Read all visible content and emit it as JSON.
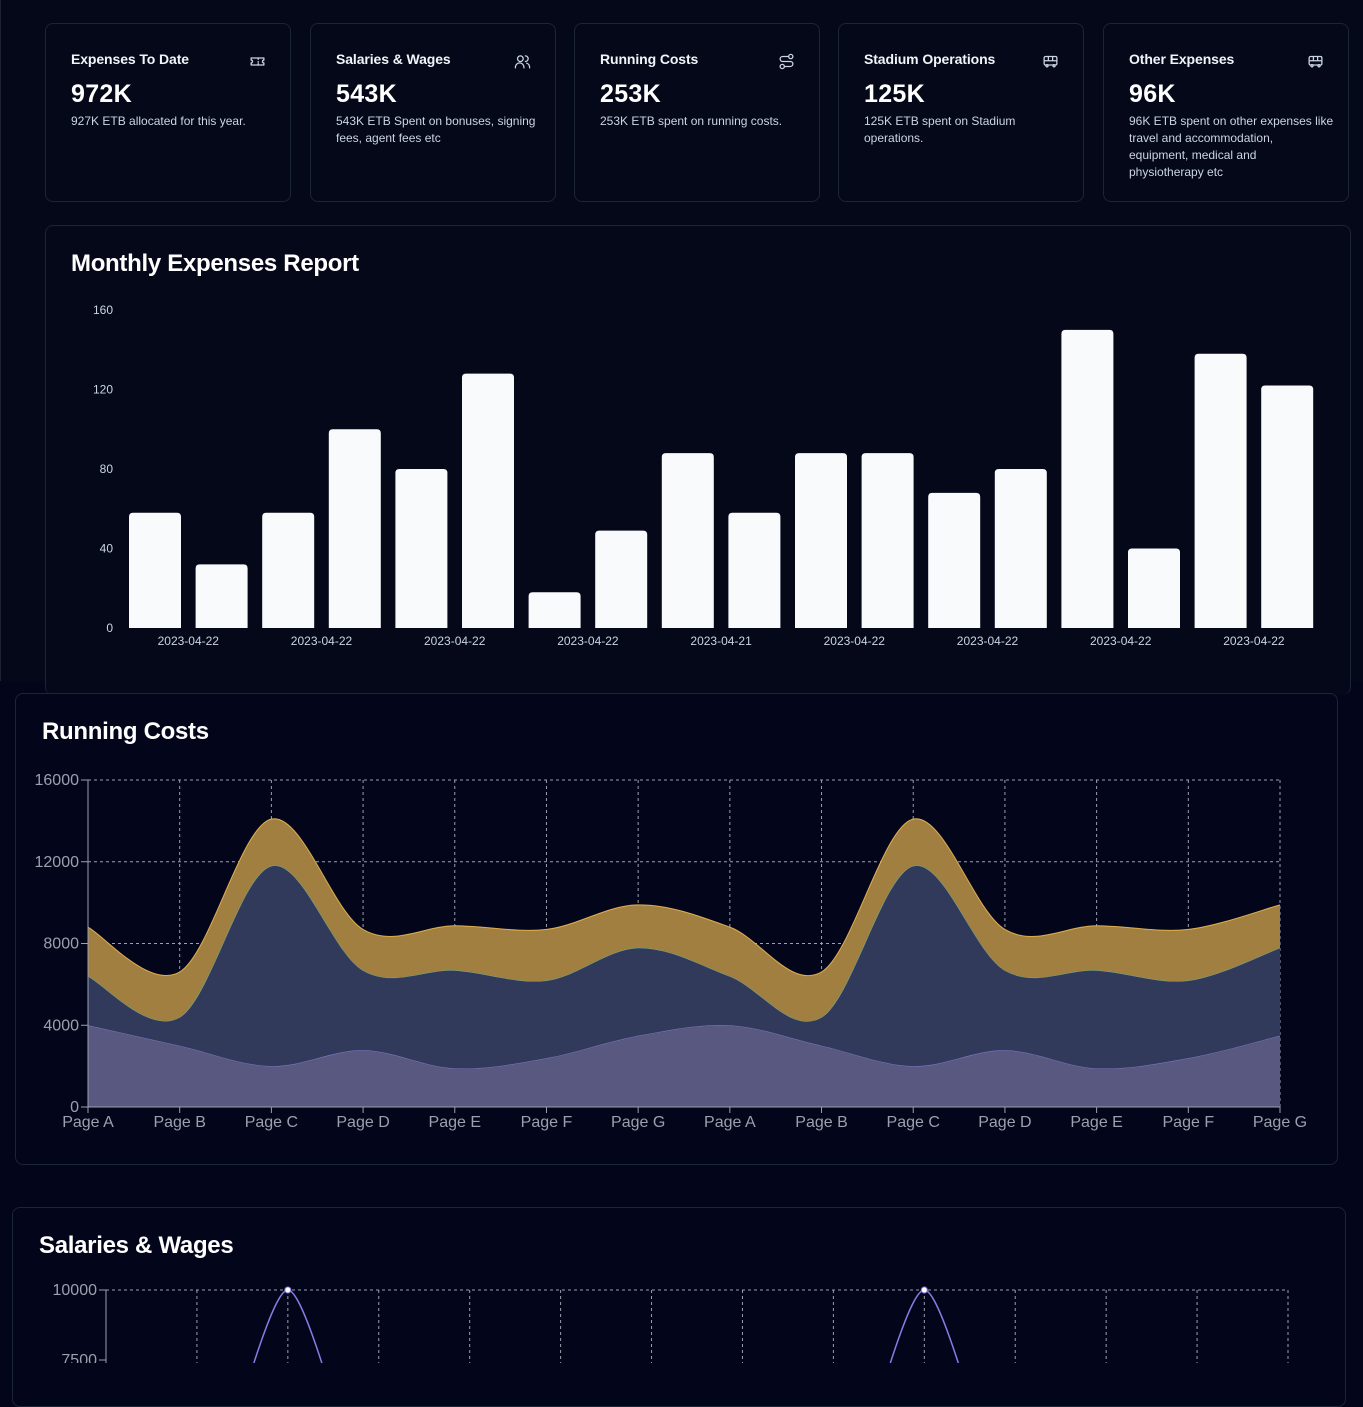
{
  "cards": [
    {
      "title": "Expenses To Date",
      "value": "972K",
      "description": "927K ETB allocated for this year.",
      "icon": "ticket-icon"
    },
    {
      "title": "Salaries & Wages",
      "value": "543K",
      "description": "543K ETB Spent on bonuses, signing fees, agent fees etc",
      "icon": "users-icon"
    },
    {
      "title": "Running Costs",
      "value": "253K",
      "description": "253K ETB spent on running costs.",
      "icon": "route-icon"
    },
    {
      "title": "Stadium Operations",
      "value": "125K",
      "description": "125K ETB spent on Stadium operations.",
      "icon": "bus-icon"
    },
    {
      "title": "Other Expenses",
      "value": "96K",
      "description": "96K ETB spent on other expenses like travel and accommodation, equipment, medical and physiotherapy etc",
      "icon": "bus-icon"
    }
  ],
  "monthly_report": {
    "title": "Monthly Expenses Report"
  },
  "running_costs": {
    "title": "Running Costs"
  },
  "salaries_wages": {
    "title": "Salaries & Wages"
  },
  "colors": {
    "background": "#03061a",
    "bar": "#f8fafc",
    "area_gold": "#a07f41",
    "area_blue": "#323a5c",
    "area_lavender": "#595880",
    "line_purple": "#8b7ae6",
    "grid": "#9aa0ad"
  },
  "chart_data": [
    {
      "type": "bar",
      "title": "Monthly Expenses Report",
      "values": [
        58,
        32,
        58,
        100,
        80,
        128,
        18,
        49,
        88,
        58,
        88,
        88,
        68,
        80,
        150,
        40,
        138,
        122
      ],
      "x_tick_labels": [
        "2023-04-22",
        "2023-04-22",
        "2023-04-22",
        "2023-04-22",
        "2023-04-21",
        "2023-04-22",
        "2023-04-22",
        "2023-04-22",
        "2023-04-22"
      ],
      "y_ticks": [
        0,
        40,
        80,
        120,
        160
      ],
      "ylim": [
        0,
        160
      ],
      "grid": false
    },
    {
      "type": "area",
      "title": "Running Costs",
      "stacked": true,
      "categories": [
        "Page A",
        "Page B",
        "Page C",
        "Page D",
        "Page E",
        "Page F",
        "Page G",
        "Page A",
        "Page B",
        "Page C",
        "Page D",
        "Page E",
        "Page F",
        "Page G"
      ],
      "series": [
        {
          "values": [
            4000,
            3000,
            2000,
            2780,
            1890,
            2390,
            3490,
            4000,
            3000,
            2000,
            2780,
            1890,
            2390,
            3490
          ]
        },
        {
          "values": [
            2400,
            1398,
            9800,
            3908,
            4800,
            3800,
            4300,
            2400,
            1398,
            9800,
            3908,
            4800,
            3800,
            4300
          ]
        },
        {
          "values": [
            2400,
            2210,
            2290,
            2000,
            2181,
            2500,
            2100,
            2400,
            2210,
            2290,
            2000,
            2181,
            2500,
            2100
          ]
        }
      ],
      "y_ticks": [
        0,
        4000,
        8000,
        12000,
        16000
      ],
      "ylim": [
        0,
        16000
      ],
      "grid": true
    },
    {
      "type": "line",
      "title": "Salaries & Wages",
      "y_ticks": [
        10000,
        7500
      ],
      "peaks_at_x_index": [
        2,
        9
      ],
      "peak_value": 10000,
      "grid": true
    }
  ]
}
